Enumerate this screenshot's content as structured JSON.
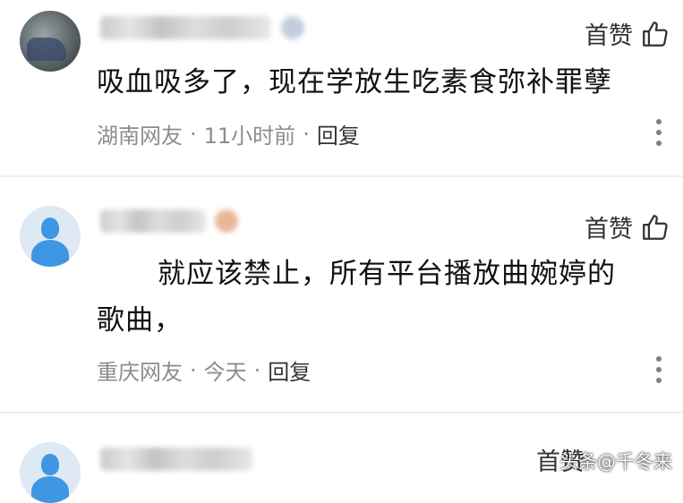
{
  "comments": [
    {
      "text": "吸血吸多了，现在学放生吃素食弥补罪孽",
      "like_label": "首赞",
      "location": "湖南网友",
      "time": "11小时前",
      "reply_label": "回复"
    },
    {
      "text_line1": "就应该禁止，所有平台播放曲婉婷的",
      "text_line2": "歌曲，",
      "like_label": "首赞",
      "location": "重庆网友",
      "time": "今天",
      "reply_label": "回复"
    },
    {
      "like_label": "首赞"
    }
  ],
  "separator": "·",
  "watermark": "头条@千冬来",
  "colors": {
    "avatar_default": "#3f97e3",
    "meta_text": "#8c8c8c",
    "reply_text": "#333333"
  }
}
